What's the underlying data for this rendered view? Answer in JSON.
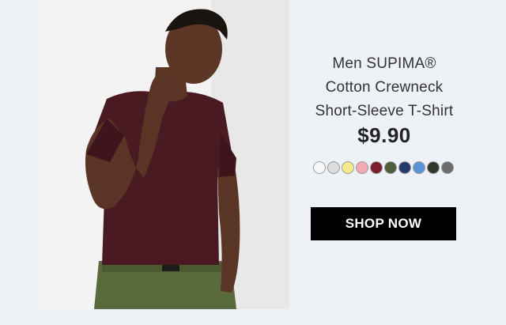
{
  "product": {
    "title_lines": [
      "Men SUPIMA®",
      "Cotton Crewneck",
      "Short-Sleeve T-Shirt"
    ],
    "price": "$9.90",
    "swatches": [
      {
        "name": "white",
        "color": "#f7f7f7"
      },
      {
        "name": "light-gray",
        "color": "#dcdcdc"
      },
      {
        "name": "yellow",
        "color": "#f4ea8c"
      },
      {
        "name": "pink",
        "color": "#f2a9b4"
      },
      {
        "name": "wine",
        "color": "#7a1f2b"
      },
      {
        "name": "olive",
        "color": "#4f5e3a"
      },
      {
        "name": "navy",
        "color": "#243a6b"
      },
      {
        "name": "blue",
        "color": "#5b93d6"
      },
      {
        "name": "dark-olive",
        "color": "#2f3a2a"
      },
      {
        "name": "gray",
        "color": "#6d6d6d"
      }
    ],
    "cta_label": "SHOP NOW"
  },
  "colors": {
    "background": "#eef2f7",
    "button": "#000000",
    "shirt": "#4a1a22",
    "pants": "#5a6a3c"
  }
}
